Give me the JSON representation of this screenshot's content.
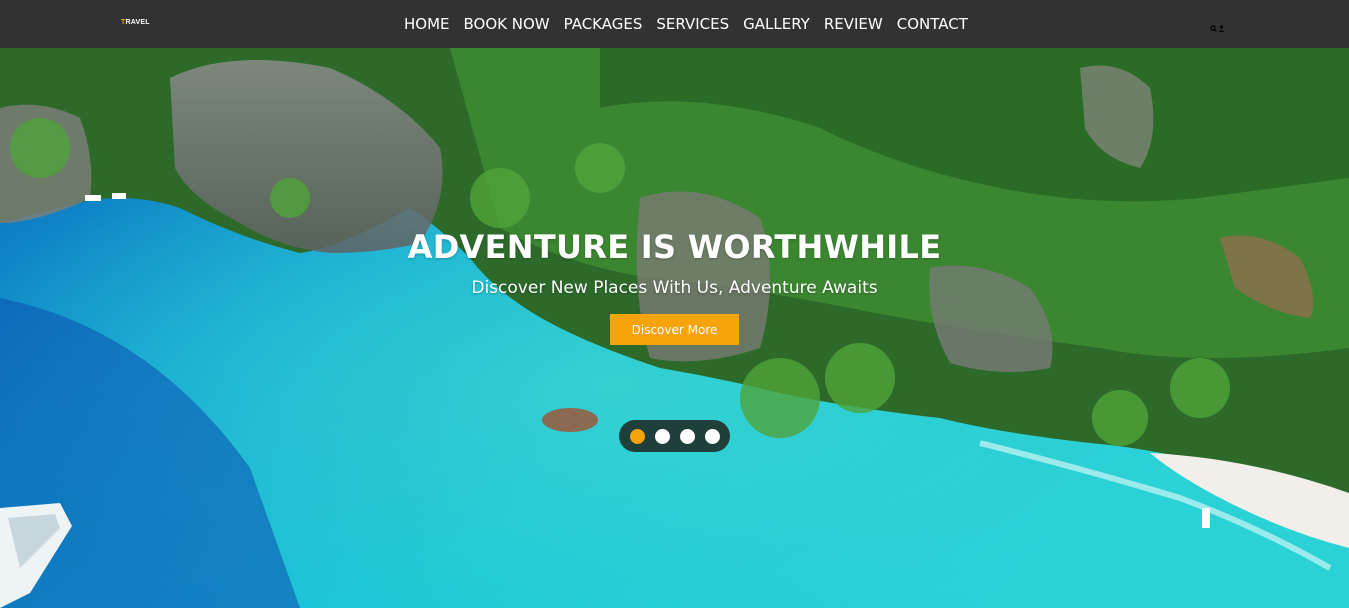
{
  "brand": {
    "first_letter": "T",
    "rest": "RAVEL",
    "accent": "#f6a50e"
  },
  "nav": {
    "links": [
      "HOME",
      "BOOK NOW",
      "PACKAGES",
      "SERVICES",
      "GALLERY",
      "REVIEW",
      "CONTACT"
    ],
    "icons": [
      "search-icon",
      "user-icon"
    ]
  },
  "hero": {
    "title": "ADVENTURE IS WORTHWHILE",
    "subtitle": "Discover New Places With Us, Adventure Awaits",
    "button_label": "Discover More",
    "button_color": "#f6a30c",
    "slides_count": 4,
    "active_slide": 1
  },
  "colors": {
    "navbar": "#333232",
    "dots_bg": "#1f3f3b"
  }
}
